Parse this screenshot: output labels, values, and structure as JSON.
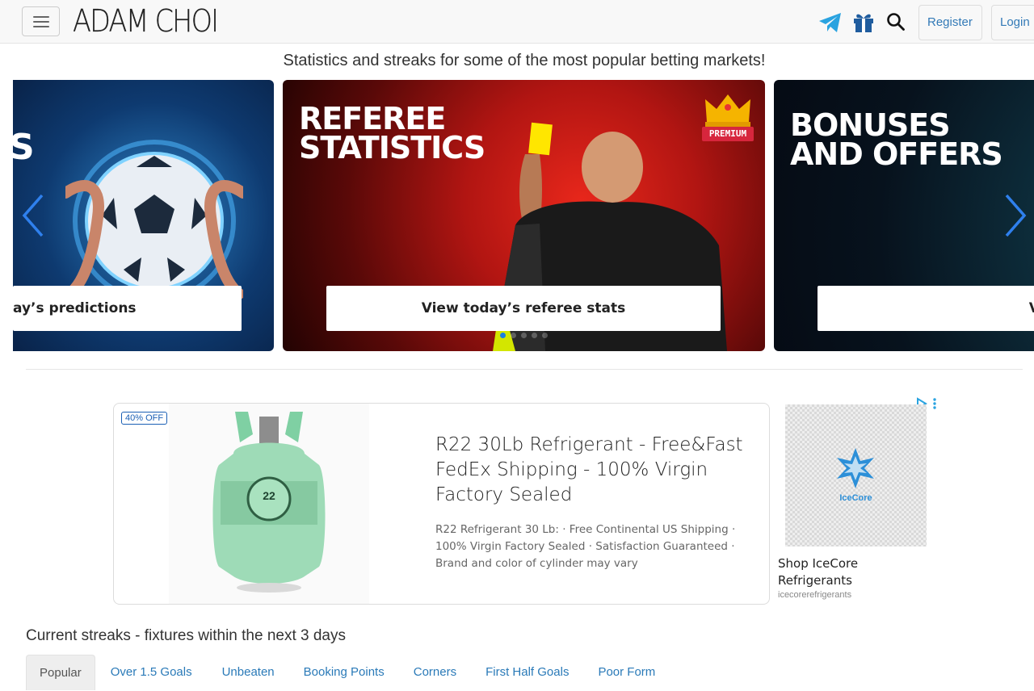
{
  "header": {
    "brand": "ADAM CHOI",
    "menu_icon": "hamburger-icon",
    "icons": [
      "telegram-icon",
      "gift-icon",
      "search-icon"
    ],
    "register_label": "Register",
    "login_label": "Login"
  },
  "tagline": "Statistics and streaks for some of the most popular betting markets!",
  "carousel": {
    "slides": [
      {
        "heading": "S",
        "cta": "ay’s predictions"
      },
      {
        "heading_line1": "REFEREE",
        "heading_line2": "STATISTICS",
        "badge": "PREMIUM",
        "cta": "View today’s referee stats"
      },
      {
        "heading_line1": "BONUSES",
        "heading_line2": "AND OFFERS",
        "cta": "View sports bett"
      }
    ],
    "dot_count": 5,
    "active_dot": 0,
    "colors": {
      "active_dot": "#1a7fe0",
      "arrow": "#2f80ed"
    }
  },
  "ad": {
    "badge": "40% OFF",
    "product_label": "22",
    "title": "R22 30Lb Refrigerant - Free&Fast FedEx Shipping - 100% Virgin Factory Sealed",
    "description": "R22 Refrigerant 30 Lb: · Free Continental US Shipping · 100% Virgin Factory Sealed · Satisfaction Guaranteed · Brand and color of cylinder may vary",
    "side_logo": "IceCore",
    "side_title": "Shop IceCore Refrigerants",
    "side_domain": "icecorerefrigerants"
  },
  "streaks": {
    "title": "Current streaks - fixtures within the next 3 days",
    "tabs": [
      "Popular",
      "Over 1.5 Goals",
      "Unbeaten",
      "Booking Points",
      "Corners",
      "First Half Goals",
      "Poor Form"
    ],
    "active_tab": 0
  },
  "colors": {
    "link": "#2a7ab8",
    "telegram": "#2aa3e0",
    "gift": "#1f5c9e"
  }
}
